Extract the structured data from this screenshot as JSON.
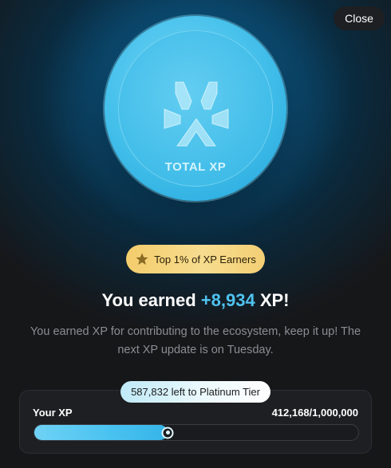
{
  "modal": {
    "close_label": "Close"
  },
  "coin": {
    "label": "TOTAL XP",
    "icon": "xp-logo-icon"
  },
  "badge": {
    "icon": "star-icon",
    "label": "Top 1% of XP Earners"
  },
  "headline": {
    "prefix": "You earned",
    "amount": "+8,934",
    "suffix": "XP!"
  },
  "description": {
    "line1": "You earned XP for contributing to the ecosystem, keep it up! The",
    "line2": "next XP update is on Tuesday."
  },
  "progress": {
    "tier_label": "587,832 left to Platinum Tier",
    "your_xp_label": "Your XP",
    "value_label": "412,168/1,000,000",
    "fraction": 0.412168
  },
  "colors": {
    "accent": "#4fc3f0",
    "badge_gold": "#f4cd6c",
    "background": "#161719"
  }
}
